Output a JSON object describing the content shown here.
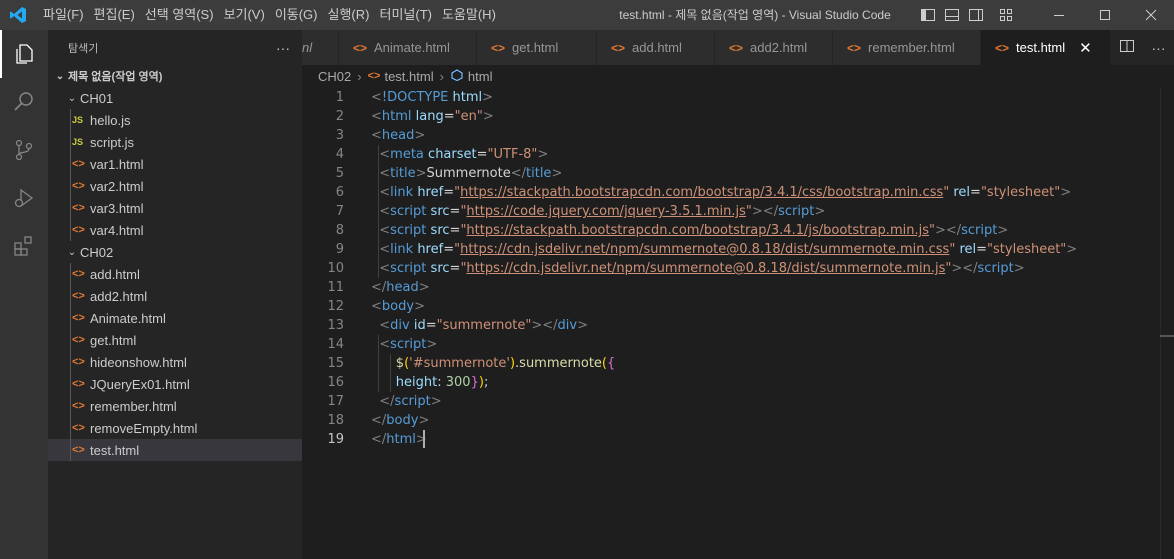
{
  "titlebar": {
    "menu": [
      "파일(F)",
      "편집(E)",
      "선택 영역(S)",
      "보기(V)",
      "이동(G)",
      "실행(R)",
      "터미널(T)",
      "도움말(H)"
    ],
    "window_title": "test.html - 제목 없음(작업 영역) - Visual Studio Code"
  },
  "explorer": {
    "title": "탐색기",
    "more": "···",
    "workspace": "제목 없음(작업 영역)",
    "folders": [
      {
        "name": "CH01",
        "files": [
          {
            "name": "hello.js",
            "type": "JS"
          },
          {
            "name": "script.js",
            "type": "JS"
          },
          {
            "name": "var1.html",
            "type": "<>"
          },
          {
            "name": "var2.html",
            "type": "<>"
          },
          {
            "name": "var3.html",
            "type": "<>"
          },
          {
            "name": "var4.html",
            "type": "<>"
          }
        ]
      },
      {
        "name": "CH02",
        "files": [
          {
            "name": "add.html",
            "type": "<>"
          },
          {
            "name": "add2.html",
            "type": "<>"
          },
          {
            "name": "Animate.html",
            "type": "<>"
          },
          {
            "name": "get.html",
            "type": "<>"
          },
          {
            "name": "hideonshow.html",
            "type": "<>"
          },
          {
            "name": "JQueryEx01.html",
            "type": "<>"
          },
          {
            "name": "remember.html",
            "type": "<>"
          },
          {
            "name": "removeEmpty.html",
            "type": "<>"
          },
          {
            "name": "test.html",
            "type": "<>"
          }
        ]
      }
    ],
    "selected": "test.html"
  },
  "tabs": [
    {
      "label": "nl",
      "partial": true
    },
    {
      "label": "Animate.html"
    },
    {
      "label": "get.html"
    },
    {
      "label": "add.html"
    },
    {
      "label": "add2.html"
    },
    {
      "label": "remember.html"
    },
    {
      "label": "test.html",
      "active": true
    }
  ],
  "tab_close": "✕",
  "breadcrumb": [
    "CH02",
    "test.html",
    "html"
  ],
  "editor": {
    "current_line": 19,
    "lines": [
      [
        [
          "t",
          "<"
        ],
        [
          "tg",
          "!DOCTYPE"
        ],
        [
          "tx",
          " "
        ],
        [
          "at",
          "html"
        ],
        [
          "t",
          ">"
        ]
      ],
      [
        [
          "t",
          "<"
        ],
        [
          "tg",
          "html"
        ],
        [
          "tx",
          " "
        ],
        [
          "at",
          "lang"
        ],
        [
          "tx",
          "="
        ],
        [
          "sv",
          "\"en\""
        ],
        [
          "t",
          ">"
        ]
      ],
      [
        [
          "t",
          "<"
        ],
        [
          "tg",
          "head"
        ],
        [
          "t",
          ">"
        ]
      ],
      [
        [
          "tx",
          "  "
        ],
        [
          "t",
          "<"
        ],
        [
          "tg",
          "meta"
        ],
        [
          "tx",
          " "
        ],
        [
          "at",
          "charset"
        ],
        [
          "tx",
          "="
        ],
        [
          "sv",
          "\"UTF-8\""
        ],
        [
          "t",
          ">"
        ]
      ],
      [
        [
          "tx",
          "  "
        ],
        [
          "t",
          "<"
        ],
        [
          "tg",
          "title"
        ],
        [
          "t",
          ">"
        ],
        [
          "tx",
          "Summernote"
        ],
        [
          "t",
          "</"
        ],
        [
          "tg",
          "title"
        ],
        [
          "t",
          ">"
        ]
      ],
      [
        [
          "tx",
          "  "
        ],
        [
          "t",
          "<"
        ],
        [
          "tg",
          "link"
        ],
        [
          "tx",
          " "
        ],
        [
          "at",
          "href"
        ],
        [
          "tx",
          "="
        ],
        [
          "sv",
          "\""
        ],
        [
          "url",
          "https://stackpath.bootstrapcdn.com/bootstrap/3.4.1/css/bootstrap.min.css"
        ],
        [
          "sv",
          "\""
        ],
        [
          "tx",
          " "
        ],
        [
          "at",
          "rel"
        ],
        [
          "tx",
          "="
        ],
        [
          "sv",
          "\"stylesheet\""
        ],
        [
          "t",
          ">"
        ]
      ],
      [
        [
          "tx",
          "  "
        ],
        [
          "t",
          "<"
        ],
        [
          "tg",
          "script"
        ],
        [
          "tx",
          " "
        ],
        [
          "at",
          "src"
        ],
        [
          "tx",
          "="
        ],
        [
          "sv",
          "\""
        ],
        [
          "url",
          "https://code.jquery.com/jquery-3.5.1.min.js"
        ],
        [
          "sv",
          "\""
        ],
        [
          "t",
          "></"
        ],
        [
          "tg",
          "script"
        ],
        [
          "t",
          ">"
        ]
      ],
      [
        [
          "tx",
          "  "
        ],
        [
          "t",
          "<"
        ],
        [
          "tg",
          "script"
        ],
        [
          "tx",
          " "
        ],
        [
          "at",
          "src"
        ],
        [
          "tx",
          "="
        ],
        [
          "sv",
          "\""
        ],
        [
          "url",
          "https://stackpath.bootstrapcdn.com/bootstrap/3.4.1/js/bootstrap.min.js"
        ],
        [
          "sv",
          "\""
        ],
        [
          "t",
          "></"
        ],
        [
          "tg",
          "script"
        ],
        [
          "t",
          ">"
        ]
      ],
      [
        [
          "tx",
          "  "
        ],
        [
          "t",
          "<"
        ],
        [
          "tg",
          "link"
        ],
        [
          "tx",
          " "
        ],
        [
          "at",
          "href"
        ],
        [
          "tx",
          "="
        ],
        [
          "sv",
          "\""
        ],
        [
          "url",
          "https://cdn.jsdelivr.net/npm/summernote@0.8.18/dist/summernote.min.css"
        ],
        [
          "sv",
          "\""
        ],
        [
          "tx",
          " "
        ],
        [
          "at",
          "rel"
        ],
        [
          "tx",
          "="
        ],
        [
          "sv",
          "\"stylesheet\""
        ],
        [
          "t",
          ">"
        ]
      ],
      [
        [
          "tx",
          "  "
        ],
        [
          "t",
          "<"
        ],
        [
          "tg",
          "script"
        ],
        [
          "tx",
          " "
        ],
        [
          "at",
          "src"
        ],
        [
          "tx",
          "="
        ],
        [
          "sv",
          "\""
        ],
        [
          "url",
          "https://cdn.jsdelivr.net/npm/summernote@0.8.18/dist/summernote.min.js"
        ],
        [
          "sv",
          "\""
        ],
        [
          "t",
          "></"
        ],
        [
          "tg",
          "script"
        ],
        [
          "t",
          ">"
        ]
      ],
      [
        [
          "t",
          "</"
        ],
        [
          "tg",
          "head"
        ],
        [
          "t",
          ">"
        ]
      ],
      [
        [
          "t",
          "<"
        ],
        [
          "tg",
          "body"
        ],
        [
          "t",
          ">"
        ]
      ],
      [
        [
          "tx",
          "  "
        ],
        [
          "t",
          "<"
        ],
        [
          "tg",
          "div"
        ],
        [
          "tx",
          " "
        ],
        [
          "at",
          "id"
        ],
        [
          "tx",
          "="
        ],
        [
          "sv",
          "\"summernote\""
        ],
        [
          "t",
          "></"
        ],
        [
          "tg",
          "div"
        ],
        [
          "t",
          ">"
        ]
      ],
      [
        [
          "tx",
          "  "
        ],
        [
          "t",
          "<"
        ],
        [
          "tg",
          "script"
        ],
        [
          "t",
          ">"
        ]
      ],
      [
        [
          "tx",
          "      "
        ],
        [
          "fn",
          "$"
        ],
        [
          "br",
          "("
        ],
        [
          "sv",
          "'#summernote'"
        ],
        [
          "br",
          ")"
        ],
        [
          "tx",
          "."
        ],
        [
          "fn",
          "summernote"
        ],
        [
          "br",
          "("
        ],
        [
          "br2",
          "{"
        ]
      ],
      [
        [
          "tx",
          "      "
        ],
        [
          "at",
          "height"
        ],
        [
          "tx",
          ": "
        ],
        [
          "num",
          "300"
        ],
        [
          "br2",
          "}"
        ],
        [
          "br",
          ")"
        ],
        [
          "tx",
          ";"
        ]
      ],
      [
        [
          "tx",
          "  "
        ],
        [
          "t",
          "</"
        ],
        [
          "tg",
          "script"
        ],
        [
          "t",
          ">"
        ]
      ],
      [
        [
          "t",
          "</"
        ],
        [
          "tg",
          "body"
        ],
        [
          "t",
          ">"
        ]
      ],
      [
        [
          "t",
          "</"
        ],
        [
          "tg",
          "html"
        ],
        [
          "t",
          ">"
        ]
      ]
    ]
  }
}
